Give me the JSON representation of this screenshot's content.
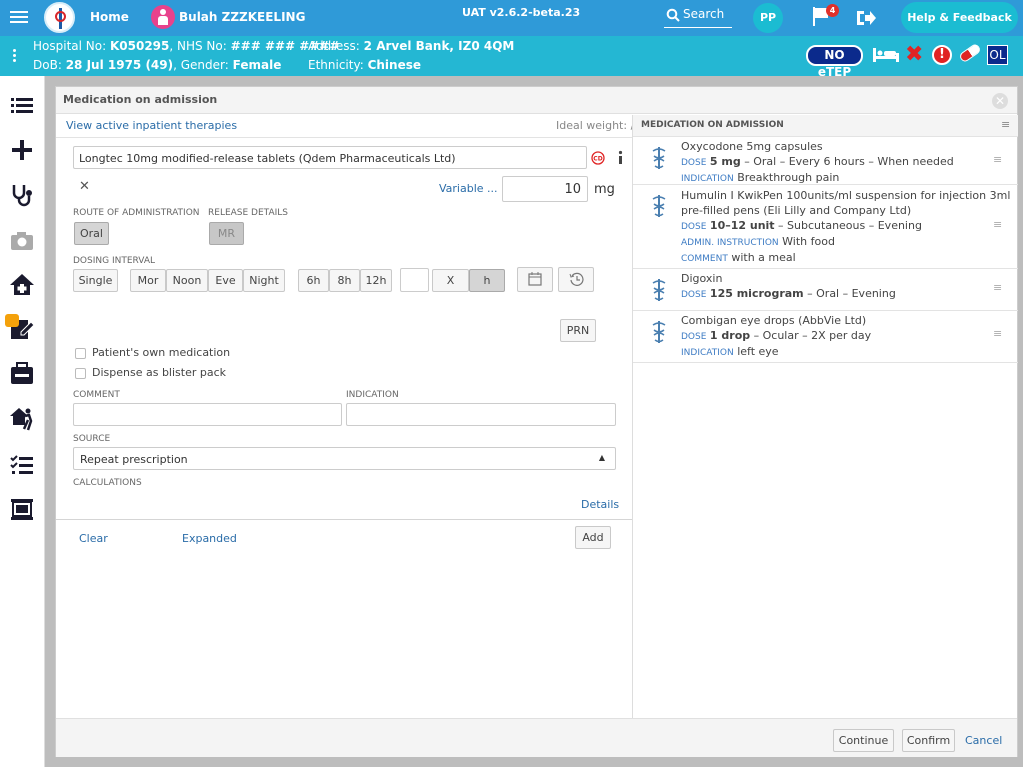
{
  "header": {
    "home": "Home",
    "patient_name": "Bulah ZZZKEELING",
    "version": "UAT v2.6.2-beta.23",
    "search": "Search",
    "user_initials": "PP",
    "flag_count": "4",
    "help": "Help & Feedback"
  },
  "patient": {
    "hospital_no_label": "Hospital No:",
    "hospital_no": "K050295",
    "nhs_no_label": ", NHS No:",
    "nhs_no": "### ### ####",
    "address_label": "Address:",
    "address": "2 Arvel Bank, IZ0 4QM",
    "dob_label": "DoB:",
    "dob": "28 Jul 1975 (49)",
    "gender_label": ", Gender:",
    "gender": "Female",
    "ethnicity_label": "Ethnicity:",
    "ethnicity": "Chinese",
    "no_etep": "NO eTEP",
    "ol": "OL"
  },
  "modal": {
    "title": "Medication on admission",
    "view_link": "View active inpatient therapies",
    "ideal_weight": "Ideal weight: /",
    "drug": "Longtec 10mg modified-release tablets (Qdem Pharmaceuticals Ltd)",
    "variable": "Variable ...",
    "dose_value": "10",
    "dose_unit": "mg",
    "route_label": "Route of administration",
    "route": "Oral",
    "release_label": "Release details",
    "release": "MR",
    "dosing_label": "Dosing interval",
    "single": "Single",
    "mor": "Mor",
    "noon": "Noon",
    "eve": "Eve",
    "night": "Night",
    "h6": "6h",
    "h8": "8h",
    "h12": "12h",
    "x": "X",
    "h": "h",
    "prn": "PRN",
    "patients_own": "Patient's own medication",
    "blister": "Dispense as blister pack",
    "comment_label": "Comment",
    "indication_label": "Indication",
    "source_label": "Source",
    "source": "Repeat prescription",
    "calculations_label": "Calculations",
    "details": "Details",
    "clear": "Clear",
    "expanded": "Expanded",
    "add": "Add",
    "continue": "Continue",
    "confirm": "Confirm",
    "cancel": "Cancel"
  },
  "admission": {
    "title": "Medication on admission",
    "items": [
      {
        "name": "Oxycodone 5mg capsules",
        "dose_key": "Dose",
        "dose": "5 mg",
        "dose_rest": " – Oral – Every 6 hours – When needed",
        "ind_key": "Indication",
        "ind": "Breakthrough pain"
      },
      {
        "name": "Humulin I KwikPen 100units/ml suspension for injection 3ml",
        "name2": "pre-filled pens (Eli Lilly and Company Ltd)",
        "dose_key": "Dose",
        "dose": "10–12 unit",
        "dose_rest": " – Subcutaneous – Evening",
        "adm_key": "Admin. instruction",
        "adm": "With food",
        "com_key": "Comment",
        "com": "with a meal"
      },
      {
        "name": "Digoxin",
        "dose_key": "Dose",
        "dose": "125 microgram",
        "dose_rest": " – Oral – Evening"
      },
      {
        "name": "Combigan eye drops (AbbVie Ltd)",
        "dose_key": "Dose",
        "dose": "1 drop",
        "dose_rest": " – Ocular – 2X per day",
        "ind_key": "Indication",
        "ind": "left eye"
      }
    ]
  }
}
